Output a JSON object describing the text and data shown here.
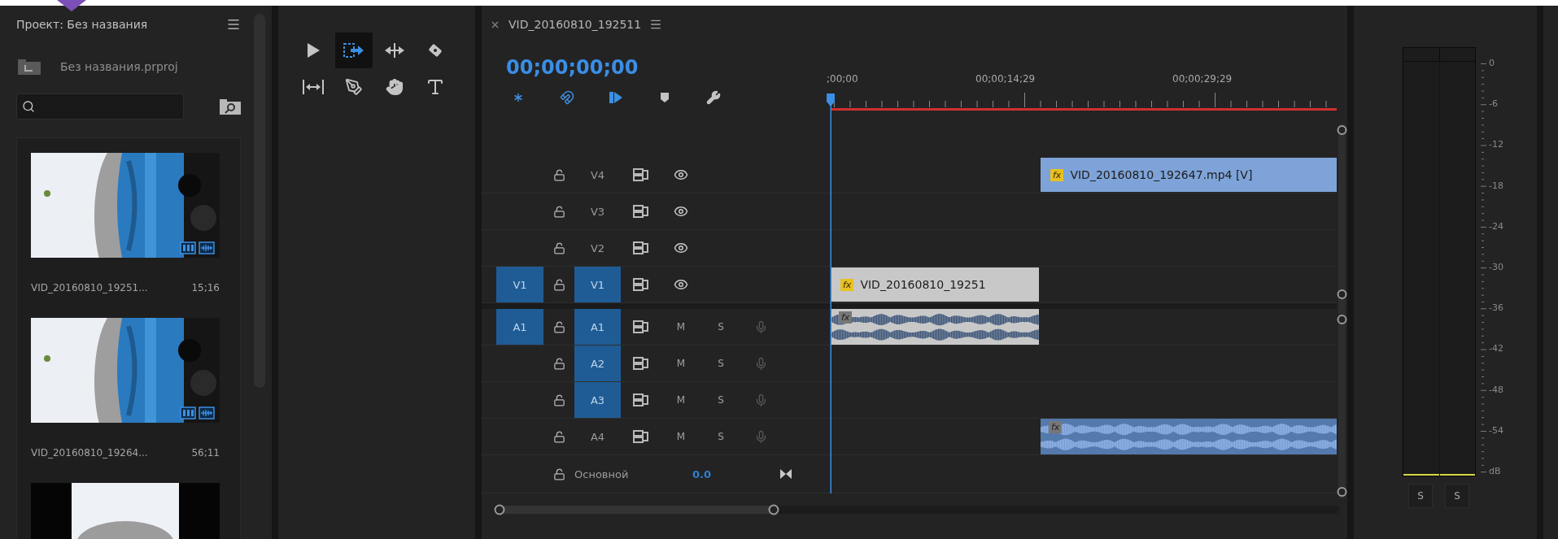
{
  "project_panel": {
    "title": "Проект: Без названия",
    "project_file": "Без названия.prproj",
    "items": [
      {
        "name": "VID_20160810_19251...",
        "duration": "15;16",
        "kind": "full"
      },
      {
        "name": "VID_20160810_19264...",
        "duration": "56;11",
        "kind": "full"
      },
      {
        "kind": "pillarbox"
      }
    ]
  },
  "tools": [
    {
      "selected": false
    },
    {
      "selected": true
    },
    {
      "selected": false
    },
    {
      "selected": false
    },
    {
      "selected": false
    },
    {
      "selected": false
    },
    {
      "selected": false
    },
    {
      "selected": false
    }
  ],
  "timeline": {
    "title": "VID_20160810_192511",
    "timecode": "00;00;00;00",
    "toolbar": [
      {
        "active": true
      },
      {
        "active": true
      },
      {
        "active": true
      },
      {
        "active": false
      },
      {
        "active": false
      }
    ],
    "ruler_labels": [
      ";00;00",
      "00;00;14;29",
      "00;00;29;29"
    ],
    "video_tracks": [
      {
        "label": "V4",
        "targeted": false,
        "clips": [
          {
            "kind": "gap"
          },
          {
            "kind": "clip",
            "name": "VID_20160810_192647.mp4 [V]",
            "effect_badge": "fx",
            "color": "#7ea3d8"
          }
        ]
      },
      {
        "label": "V3",
        "targeted": false
      },
      {
        "label": "V2",
        "targeted": false
      },
      {
        "label": "V1",
        "source": "V1",
        "targeted": true,
        "clips": [
          {
            "kind": "clip",
            "name": "VID_20160810_19251",
            "effect_badge": "fx",
            "color": "#c8c8c8"
          }
        ]
      }
    ],
    "audio_tracks": [
      {
        "label": "A1",
        "source": "A1",
        "targeted": true,
        "mute": "M",
        "solo": "S",
        "clips": [
          {
            "kind": "clip",
            "effect_badge": "fx",
            "color": "#c8c8c8"
          }
        ]
      },
      {
        "label": "A2",
        "targeted": true,
        "mute": "M",
        "solo": "S"
      },
      {
        "label": "A3",
        "targeted": true,
        "mute": "M",
        "solo": "S"
      },
      {
        "label": "A4",
        "targeted": false,
        "mute": "M",
        "solo": "S",
        "clips": [
          {
            "kind": "gap"
          },
          {
            "kind": "clip",
            "effect_badge": "fx",
            "color": "#5479ac"
          }
        ]
      }
    ],
    "master": {
      "label": "Основной",
      "value": "0.0"
    }
  },
  "meter": {
    "scale": [
      "0",
      "-6",
      "-12",
      "-18",
      "-24",
      "-30",
      "-36",
      "-42",
      "-48",
      "-54",
      "dB"
    ],
    "channels": [
      {
        "solo": "S",
        "level": 0
      },
      {
        "solo": "S",
        "level": 0
      }
    ]
  }
}
